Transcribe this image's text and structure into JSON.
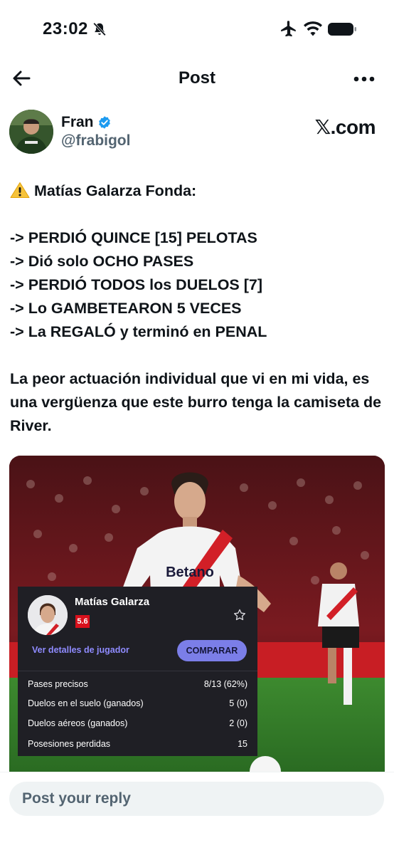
{
  "status_bar": {
    "time": "23:02",
    "icons": [
      "bell-off-icon",
      "airplane-icon",
      "wifi-icon",
      "battery-icon"
    ]
  },
  "nav": {
    "title": "Post",
    "back_icon": "arrow-left-icon",
    "more_icon": "more-horizontal-icon"
  },
  "author": {
    "name": "Fran",
    "handle": "@frabigol",
    "verified": true,
    "verified_color": "#1d9bf0"
  },
  "source_mark": "𝕏.com",
  "tweet": {
    "heading": "Matías Galarza Fonda:",
    "heading_icon": "warning-icon",
    "lines": [
      "-> PERDIÓ QUINCE [15] PELOTAS",
      "-> Dió solo OCHO PASES",
      "-> PERDIÓ TODOS los DUELOS [7]",
      "-> Lo GAMBETEARON 5 VECES",
      "-> La REGALÓ y terminó en PENAL"
    ],
    "closing": "La peor actuación individual que vi en mi vida, es una vergüenza que este burro tenga la camiseta de River."
  },
  "media": {
    "shirt_text": "Betano",
    "card": {
      "player_name": "Matías Galarza",
      "rating": "5.6",
      "rating_color": "#d8101c",
      "details_link": "Ver detalles de jugador",
      "compare_button": "COMPARAR",
      "stats": [
        {
          "label": "Pases precisos",
          "value": "8/13 (62%)"
        },
        {
          "label": "Duelos en el suelo (ganados)",
          "value": "5 (0)"
        },
        {
          "label": "Duelos aéreos (ganados)",
          "value": "2 (0)"
        },
        {
          "label": "Posesiones perdidas",
          "value": "15"
        }
      ]
    }
  },
  "reply": {
    "placeholder": "Post your reply"
  }
}
